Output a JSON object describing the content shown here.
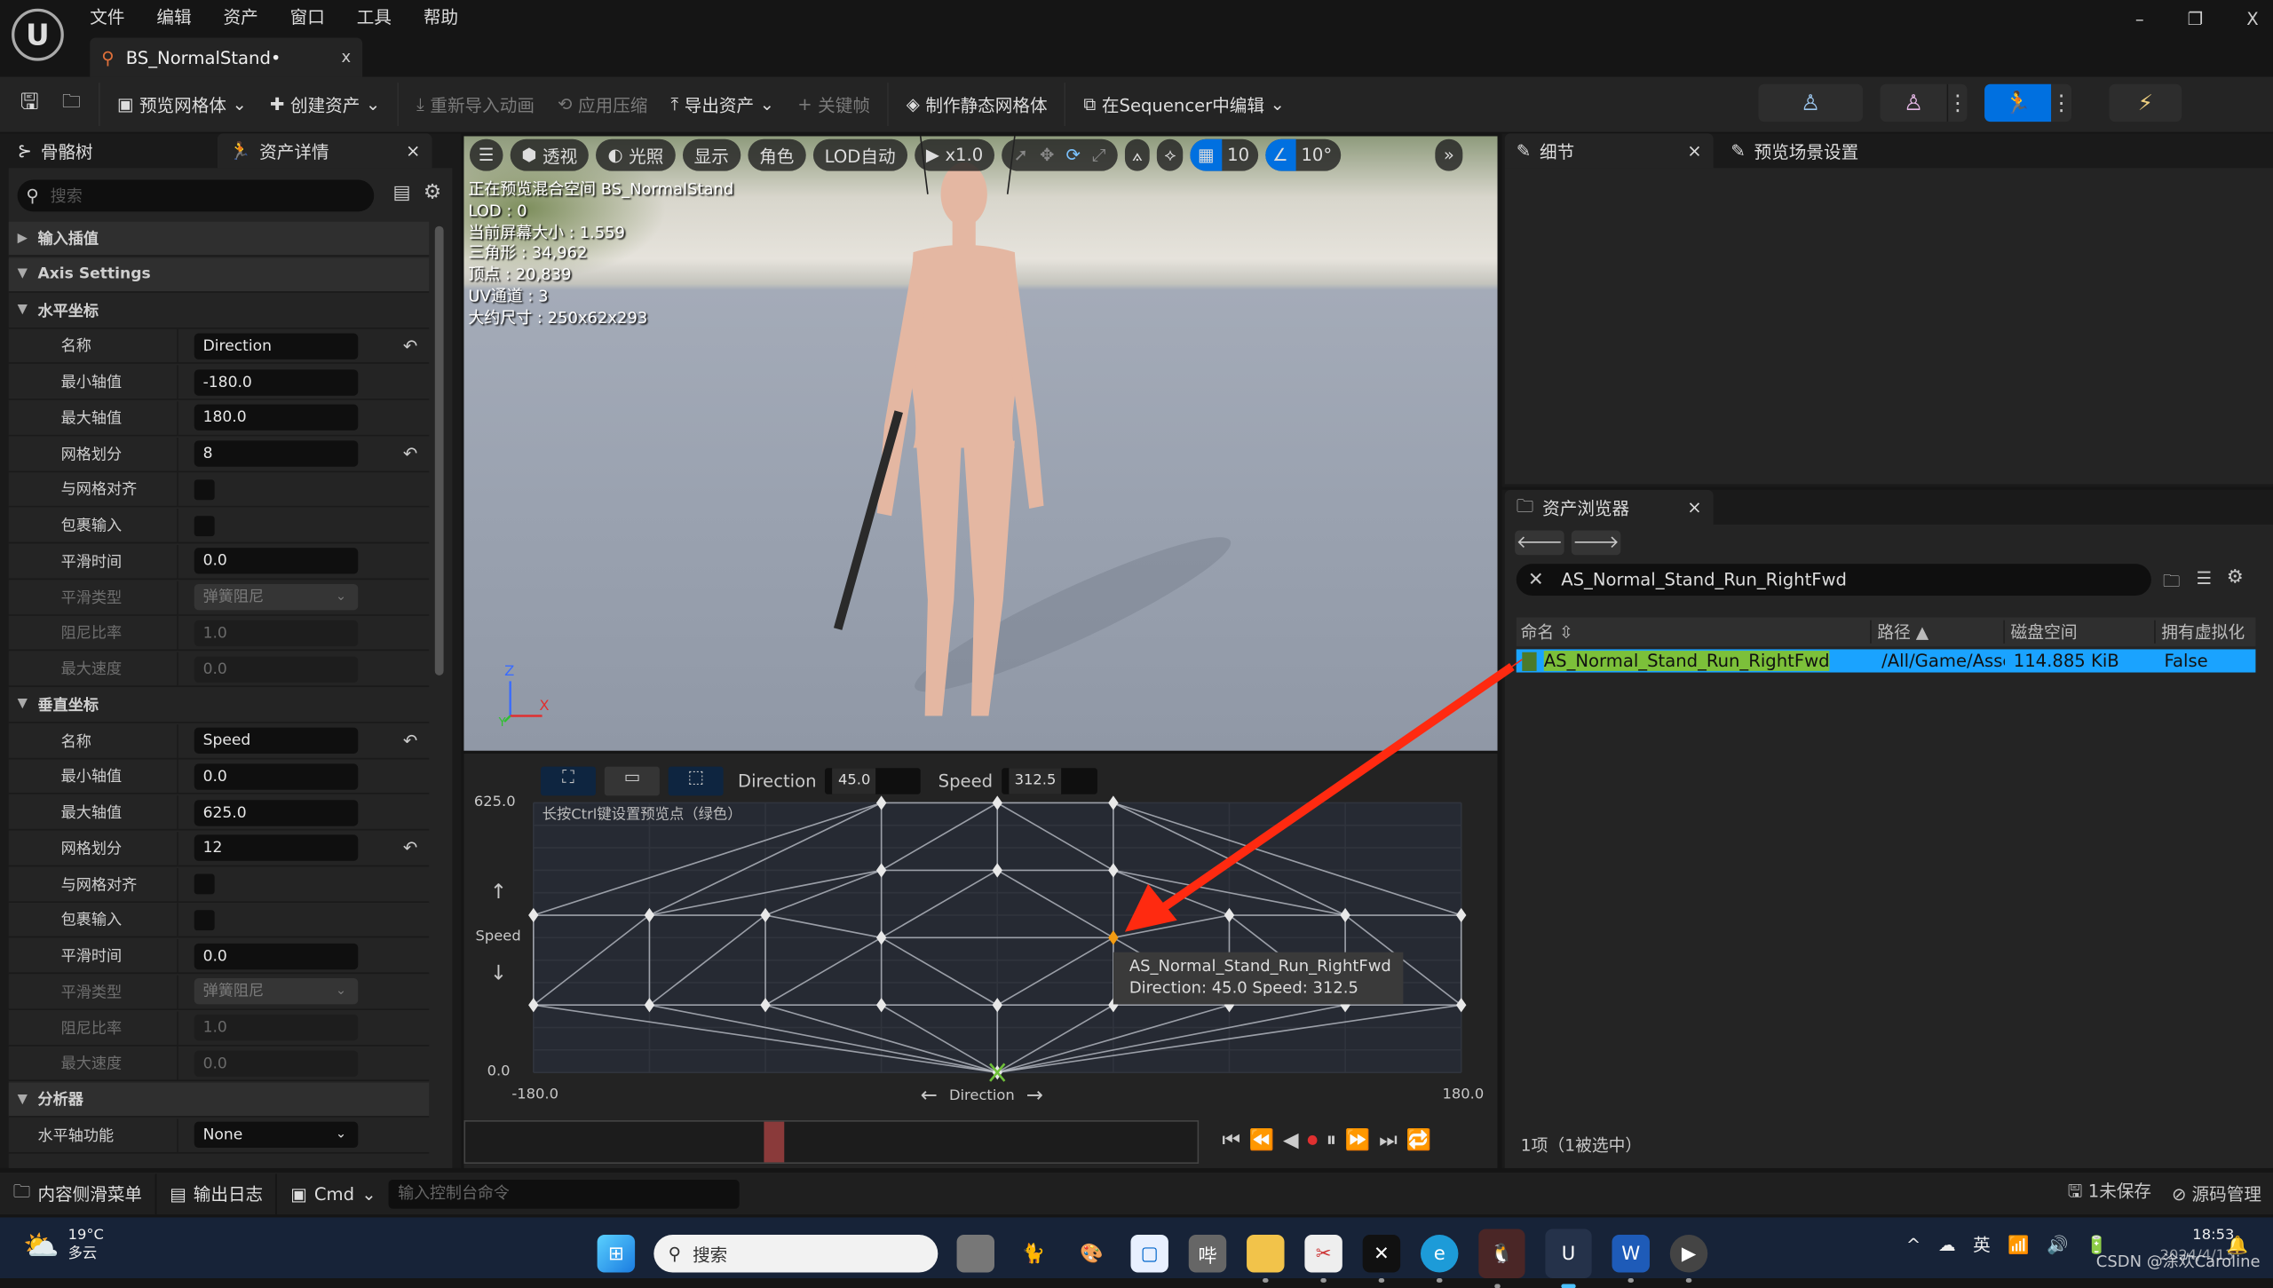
{
  "window": {
    "menu": [
      "文件",
      "编辑",
      "资产",
      "窗口",
      "工具",
      "帮助"
    ],
    "tab_title": "BS_NormalStand•",
    "tab_close": "x",
    "controls": {
      "minimize": "–",
      "restore": "❐",
      "close": "X"
    }
  },
  "toolbar": {
    "items": [
      {
        "label": "预览网格体",
        "dropdown": true,
        "disabled": false,
        "icon": "preview-mesh-icon"
      },
      {
        "label": "创建资产",
        "dropdown": true,
        "disabled": false,
        "icon": "create-asset-icon"
      },
      {
        "label": "重新导入动画",
        "dropdown": false,
        "disabled": true,
        "icon": "reimport-icon"
      },
      {
        "label": "应用压缩",
        "dropdown": false,
        "disabled": true,
        "icon": "compress-icon"
      },
      {
        "label": "导出资产",
        "dropdown": true,
        "disabled": false,
        "icon": "export-icon"
      },
      {
        "label": "关键帧",
        "dropdown": false,
        "disabled": true,
        "icon": "plus-icon"
      },
      {
        "label": "制作静态网格体",
        "dropdown": false,
        "disabled": false,
        "icon": "static-mesh-icon"
      },
      {
        "label": "在Sequencer中编辑",
        "dropdown": true,
        "disabled": false,
        "icon": "sequencer-icon"
      }
    ],
    "modes": [
      "skeleton",
      "mesh",
      "animation",
      "blueprint"
    ],
    "active_mode": "animation",
    "accent": "#0070e0"
  },
  "left_panel": {
    "tabs": [
      "骨骼树",
      "资产详情"
    ],
    "search_placeholder": "搜索",
    "rows": [
      {
        "type": "cat",
        "label": "输入插值",
        "expanded": false
      },
      {
        "type": "cat",
        "label": "Axis Settings",
        "expanded": true
      },
      {
        "type": "grp",
        "label": "水平坐标",
        "expanded": true
      },
      {
        "type": "prop",
        "label": "名称",
        "kind": "text",
        "value": "Direction",
        "reset": true
      },
      {
        "type": "prop",
        "label": "最小轴值",
        "kind": "text",
        "value": "-180.0"
      },
      {
        "type": "prop",
        "label": "最大轴值",
        "kind": "text",
        "value": "180.0"
      },
      {
        "type": "prop",
        "label": "网格划分",
        "kind": "text",
        "value": "8",
        "reset": true
      },
      {
        "type": "prop",
        "label": "与网格对齐",
        "kind": "checkbox",
        "checked": false
      },
      {
        "type": "prop",
        "label": "包裹输入",
        "kind": "checkbox",
        "checked": false
      },
      {
        "type": "prop",
        "label": "平滑时间",
        "kind": "text",
        "value": "0.0"
      },
      {
        "type": "prop",
        "label": "平滑类型",
        "kind": "dropdown",
        "value": "弹簧阻尼",
        "disabled": true
      },
      {
        "type": "prop",
        "label": "阻尼比率",
        "kind": "text",
        "value": "1.0",
        "disabled": true
      },
      {
        "type": "prop",
        "label": "最大速度",
        "kind": "text",
        "value": "0.0",
        "disabled": true
      },
      {
        "type": "grp",
        "label": "垂直坐标",
        "expanded": true
      },
      {
        "type": "prop",
        "label": "名称",
        "kind": "text",
        "value": "Speed",
        "reset": true
      },
      {
        "type": "prop",
        "label": "最小轴值",
        "kind": "text",
        "value": "0.0"
      },
      {
        "type": "prop",
        "label": "最大轴值",
        "kind": "text",
        "value": "625.0"
      },
      {
        "type": "prop",
        "label": "网格划分",
        "kind": "text",
        "value": "12",
        "reset": true
      },
      {
        "type": "prop",
        "label": "与网格对齐",
        "kind": "checkbox",
        "checked": false
      },
      {
        "type": "prop",
        "label": "包裹输入",
        "kind": "checkbox",
        "checked": false
      },
      {
        "type": "prop",
        "label": "平滑时间",
        "kind": "text",
        "value": "0.0"
      },
      {
        "type": "prop",
        "label": "平滑类型",
        "kind": "dropdown",
        "value": "弹簧阻尼",
        "disabled": true
      },
      {
        "type": "prop",
        "label": "阻尼比率",
        "kind": "text",
        "value": "1.0",
        "disabled": true
      },
      {
        "type": "prop",
        "label": "最大速度",
        "kind": "text",
        "value": "0.0",
        "disabled": true
      },
      {
        "type": "cat",
        "label": "分析器",
        "expanded": true
      },
      {
        "type": "prop",
        "label": "水平轴功能",
        "kind": "dropdown",
        "value": "None",
        "disabled": false,
        "top": true
      }
    ]
  },
  "viewport": {
    "buttons": {
      "menu": "☰",
      "perspective": "透视",
      "lighting": "光照",
      "show": "显示",
      "character": "角色",
      "lod": "LOD自动",
      "speed": "x1.0",
      "grid": "10",
      "angle": "10°",
      "more": "»"
    },
    "stats": [
      "正在预览混合空间 BS_NormalStand",
      "LOD : 0",
      "当前屏幕大小 : 1.559",
      "三角形 : 34,962",
      "顶点 : 20,839",
      "UV通道 : 3",
      "大约尺寸 : 250x62x293"
    ],
    "axis": {
      "z": "Z",
      "x": "X",
      "y": "Y"
    }
  },
  "blend_space": {
    "direction_label": "Direction",
    "direction_value": "45.0",
    "speed_label": "Speed",
    "speed_value": "312.5",
    "hint": "长按Ctrl键设置预览点（绿色）",
    "x_axis": {
      "label": "Direction",
      "min": -180.0,
      "max": 180.0,
      "min_label": "-180.0",
      "max_label": "180.0",
      "divisions": 8
    },
    "y_axis": {
      "label": "Speed",
      "min": 0.0,
      "max": 625.0,
      "min_label": "0.0",
      "max_label": "625.0",
      "divisions": 12
    },
    "samples": [
      [
        -45,
        625
      ],
      [
        0,
        625
      ],
      [
        45,
        625
      ],
      [
        -45,
        468.75
      ],
      [
        0,
        468.75
      ],
      [
        45,
        468.75
      ],
      [
        -180,
        364.58
      ],
      [
        -135,
        364.58
      ],
      [
        -90,
        364.58
      ],
      [
        90,
        364.58
      ],
      [
        135,
        364.58
      ],
      [
        180,
        364.58
      ],
      [
        -45,
        312.5
      ],
      [
        45,
        312.5
      ],
      [
        -180,
        156.25
      ],
      [
        -135,
        156.25
      ],
      [
        -90,
        156.25
      ],
      [
        -45,
        156.25
      ],
      [
        0,
        156.25
      ],
      [
        45,
        156.25
      ],
      [
        90,
        156.25
      ],
      [
        135,
        156.25
      ],
      [
        180,
        156.25
      ],
      [
        0,
        0
      ]
    ],
    "selected_sample": [
      45,
      312.5
    ],
    "preview_point": [
      0,
      0
    ],
    "tooltip": {
      "name": "AS_Normal_Stand_Run_RightFwd",
      "detail": "Direction: 45.0  Speed: 312.5"
    },
    "colors": {
      "selected": "#f39c12",
      "preview": "#6fbf3a",
      "annotation_arrow": "#ff2a10"
    },
    "playhead_fraction": 0.42
  },
  "right_panel": {
    "tabs": [
      "细节",
      "预览场景设置"
    ],
    "asset_browser": {
      "tab": "资产浏览器",
      "search_value": "AS_Normal_Stand_Run_RightFwd",
      "columns": [
        "命名",
        "路径",
        "磁盘空间",
        "拥有虚拟化"
      ],
      "rows": [
        {
          "name": "AS_Normal_Stand_Run_RightFwd",
          "path": "/All/Game/Asse",
          "size": "114.885 KiB",
          "virtualized": "False"
        }
      ],
      "footer": "1项（1被选中）",
      "selection_color": "#1aa3ff"
    }
  },
  "status_bar": {
    "content_drawer": "内容侧滑菜单",
    "output_log": "输出日志",
    "cmd": "Cmd",
    "console_placeholder": "输入控制台命令",
    "unsaved": "1未保存",
    "source_control": "源码管理"
  },
  "taskbar": {
    "weather_temp": "19°C",
    "weather_desc": "多云",
    "search": "搜索",
    "ime": "英",
    "time": "18:53",
    "date": "2024/4/13",
    "watermark": "CSDN @涂欢Caroline"
  }
}
